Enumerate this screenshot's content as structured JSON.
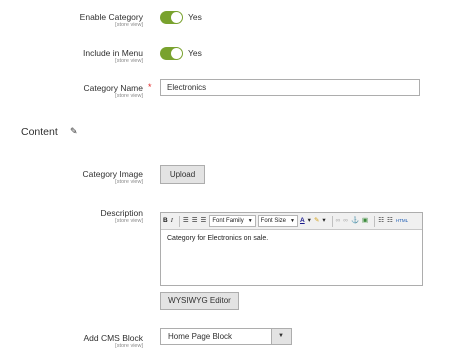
{
  "fields": {
    "enable_category": {
      "label": "Enable Category",
      "scope": "[store view]",
      "value_text": "Yes",
      "on": true
    },
    "include_in_menu": {
      "label": "Include in Menu",
      "scope": "[store view]",
      "value_text": "Yes",
      "on": true
    },
    "category_name": {
      "label": "Category Name",
      "scope": "[store view]",
      "required_mark": "*",
      "value": "Electronics"
    }
  },
  "content_section": {
    "title": "Content",
    "edit_icon": "pencil-icon",
    "category_image": {
      "label": "Category Image",
      "scope": "[store view]",
      "upload_label": "Upload"
    },
    "description": {
      "label": "Description",
      "scope": "[store view]",
      "toolbar": {
        "bold": "B",
        "italic": "I",
        "font_family": "Font Family",
        "font_size": "Font Size",
        "font_color": "A",
        "html": "HTML"
      },
      "text": "Category for Electronics on sale.",
      "wysiwyg_button": "WYSIWYG Editor"
    },
    "cms_block": {
      "label": "Add CMS Block",
      "scope": "[store view]",
      "value": "Home Page Block"
    }
  },
  "colors": {
    "toggle_on": "#79a22e",
    "required": "#e22626"
  }
}
